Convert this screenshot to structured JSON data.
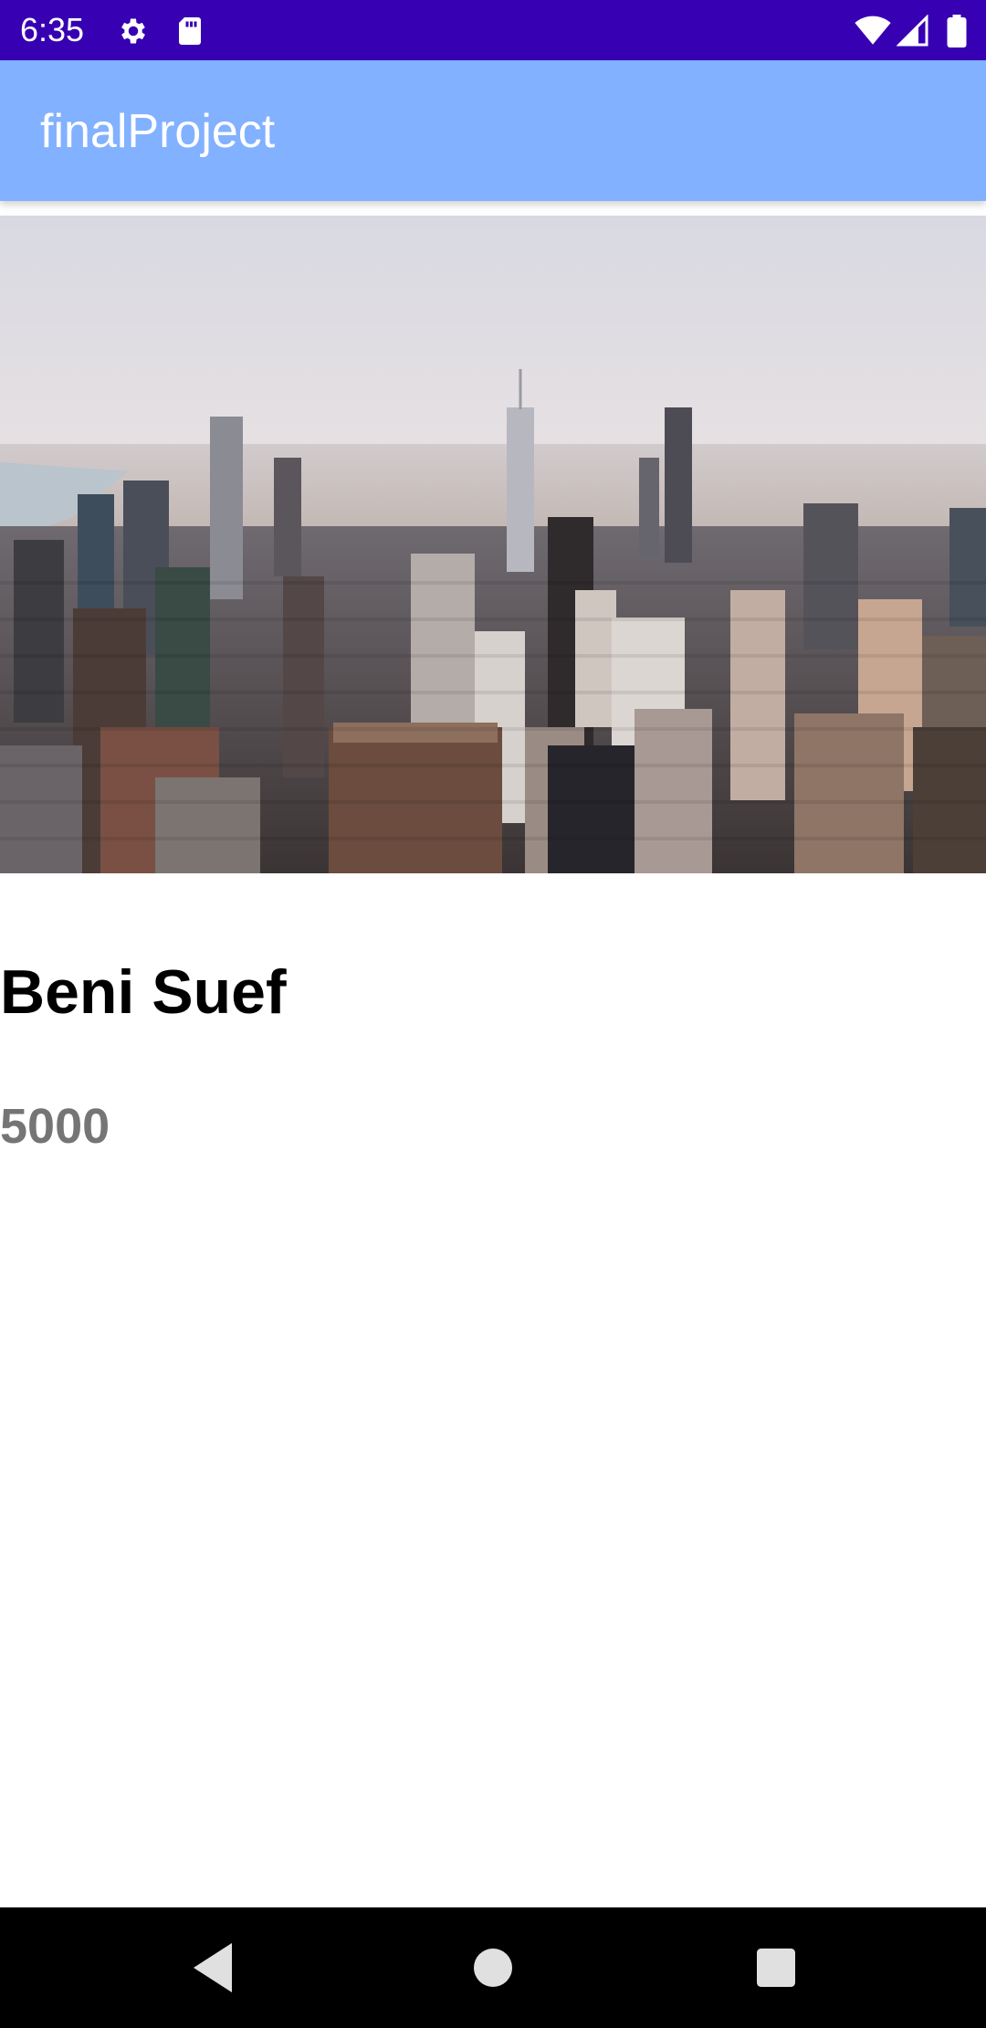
{
  "status_bar": {
    "time": "6:35",
    "background": "#3700b3",
    "icons_left": [
      "gear-icon",
      "sd-card-icon"
    ],
    "icons_right": [
      "wifi-icon",
      "cell-signal-icon",
      "battery-icon"
    ]
  },
  "app_bar": {
    "title": "finalProject",
    "background": "#82b1ff"
  },
  "hero_image": {
    "description_icon": "city-skyline-image"
  },
  "content": {
    "city_name": "Beni Suef",
    "value": "5000",
    "value_color": "#757575"
  },
  "nav_bar": {
    "buttons": [
      "back-icon",
      "home-icon",
      "recents-icon"
    ]
  }
}
